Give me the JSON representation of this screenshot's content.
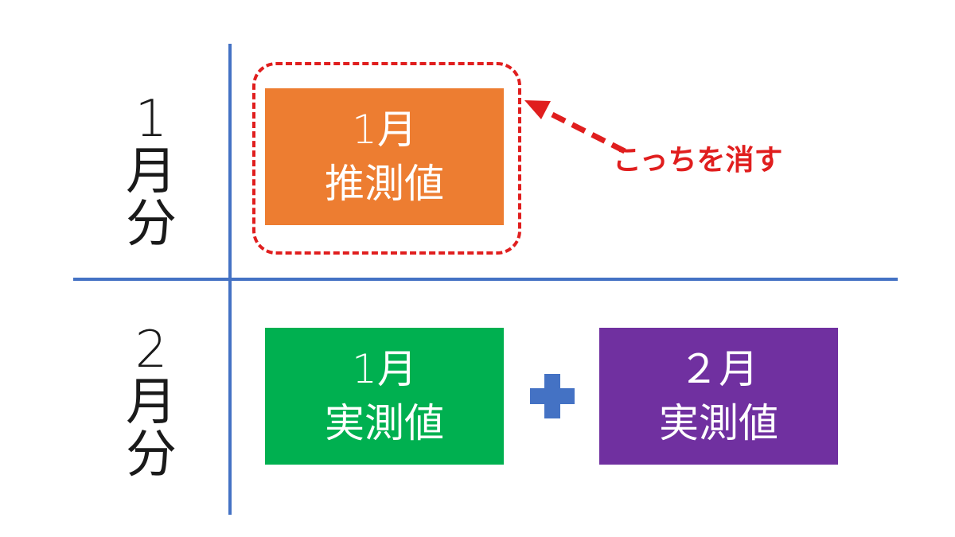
{
  "colors": {
    "axis_line": "#4472c4",
    "estimate_box": "#ed7d31",
    "actual_box_1": "#00b050",
    "actual_box_2": "#7030a0",
    "highlight": "#e01e1e",
    "plus": "#4472c4"
  },
  "rows": [
    {
      "label": [
        "1",
        "月",
        "分"
      ]
    },
    {
      "label": [
        "2",
        "月",
        "分"
      ]
    }
  ],
  "boxes": {
    "estimate": {
      "line1": "1月",
      "line2": "推測値"
    },
    "actual_1": {
      "line1": "1月",
      "line2": "実測値"
    },
    "actual_2": {
      "line1": "２月",
      "line2": "実測値"
    }
  },
  "annotation": {
    "text": "こっちを消す"
  },
  "operator": {
    "icon": "plus-icon"
  }
}
